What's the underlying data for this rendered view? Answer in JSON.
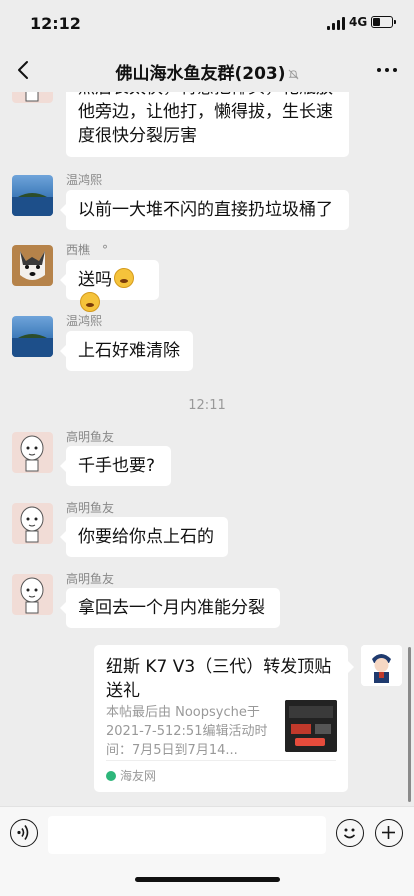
{
  "status_bar": {
    "time": "12:12",
    "network": "4G",
    "battery_level": 0.4
  },
  "nav": {
    "title": "佛山海水鱼友群(203)",
    "muted": true
  },
  "messages": [
    {
      "text_lines": [
        "然后长太快，特意把椰头，花瓶放",
        "他旁边，让他打，懒得拔，生长速",
        "度很快分裂厉害"
      ]
    },
    {
      "sender": "温鸿熙",
      "text": "以前一大堆不闪的直接扔垃圾桶了"
    },
    {
      "sender": "西樵　°",
      "text": "送吗"
    },
    {
      "sender": "温鸿熙",
      "text": "上石好难清除"
    },
    {
      "sender": "高明鱼友",
      "text": "千手也要?"
    },
    {
      "sender": "高明鱼友",
      "text": "你要给你点上石的"
    },
    {
      "sender": "高明鱼友",
      "text": "拿回去一个月内准能分裂"
    }
  ],
  "time_label": "12:11",
  "shared_card": {
    "title": "纽斯 K7 V3（三代）转发顶贴送礼",
    "description": "本帖最后由 Noopsyche于2021-7-512:51编辑活动时间：7月5日到7月14...",
    "source": "海友网"
  },
  "input": {
    "value": "",
    "placeholder": ""
  },
  "colors": {
    "background": "#ededed",
    "bubble": "#ffffff",
    "source_icon": "#2db67a"
  }
}
